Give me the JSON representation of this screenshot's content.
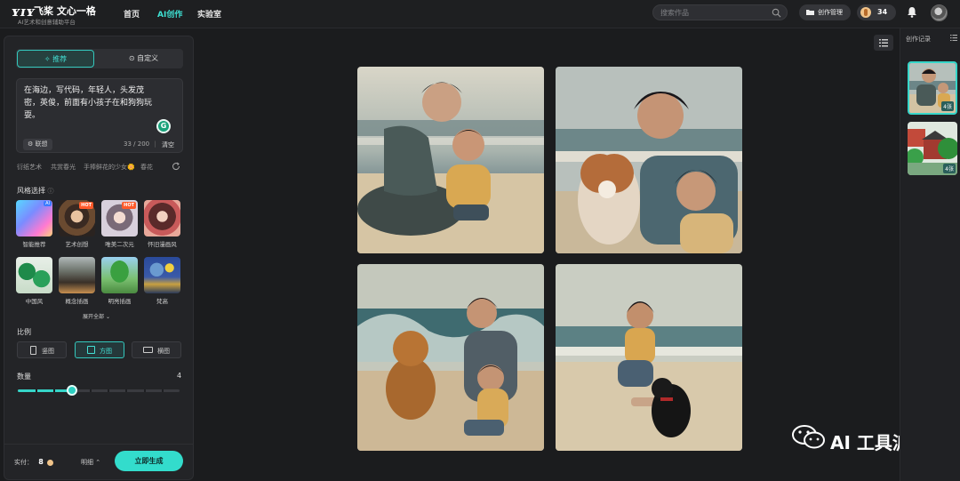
{
  "header": {
    "logo_mark": "ʏɪʏ",
    "logo_name": "飞桨 文心一格",
    "logo_sub": "AI艺术和创意辅助平台",
    "nav": [
      {
        "label": "首页",
        "active": false
      },
      {
        "label": "AI创作",
        "active": true
      },
      {
        "label": "实验室",
        "active": false
      }
    ],
    "search_placeholder": "搜索作品",
    "manage_label": "创作管理",
    "credits": "34"
  },
  "left_panel": {
    "tabs": [
      {
        "label": "推荐",
        "icon": "sparkle-icon",
        "active": true
      },
      {
        "label": "自定义",
        "icon": "target-icon",
        "active": false
      }
    ],
    "prompt_text": "在海边，写代码，年轻人，头发茂密，英俊，前面有小孩子在和狗狗玩耍。",
    "g_icon": "G",
    "assoc_label": "联想",
    "char_count": "33",
    "char_max": "200",
    "clear_label": "清空",
    "suggestions": [
      "衍纸艺术",
      "共赏春光",
      "手捧鲜花的少女🌼",
      "春花"
    ],
    "style_label": "风格选择",
    "styles": [
      {
        "name": "智能推荐",
        "badge": "AI"
      },
      {
        "name": "艺术创想",
        "badge": "HOT"
      },
      {
        "name": "唯美二次元",
        "badge": "HOT"
      },
      {
        "name": "怀旧漫画风",
        "badge": ""
      },
      {
        "name": "中国风",
        "badge": ""
      },
      {
        "name": "概念插画",
        "badge": ""
      },
      {
        "name": "明亮插画",
        "badge": ""
      },
      {
        "name": "梵高",
        "badge": ""
      }
    ],
    "expand_label": "展开全部",
    "ratio_label": "比例",
    "ratios": [
      {
        "label": "竖图",
        "active": false
      },
      {
        "label": "方图",
        "active": true
      },
      {
        "label": "横图",
        "active": false
      }
    ],
    "quantity_label": "数量",
    "quantity_value": "4",
    "quantity_max": 10,
    "pay_label": "实付：",
    "pay_value": "8",
    "detail_label": "明细",
    "generate_label": "立即生成"
  },
  "history": {
    "title": "创作记录",
    "items": [
      {
        "count": "4张",
        "active": true
      },
      {
        "count": "4张",
        "active": false
      }
    ]
  },
  "watermark": "AI 工具派",
  "colors": {
    "accent": "#33dccc",
    "background": "#1b1c1e",
    "panel": "#232427"
  }
}
